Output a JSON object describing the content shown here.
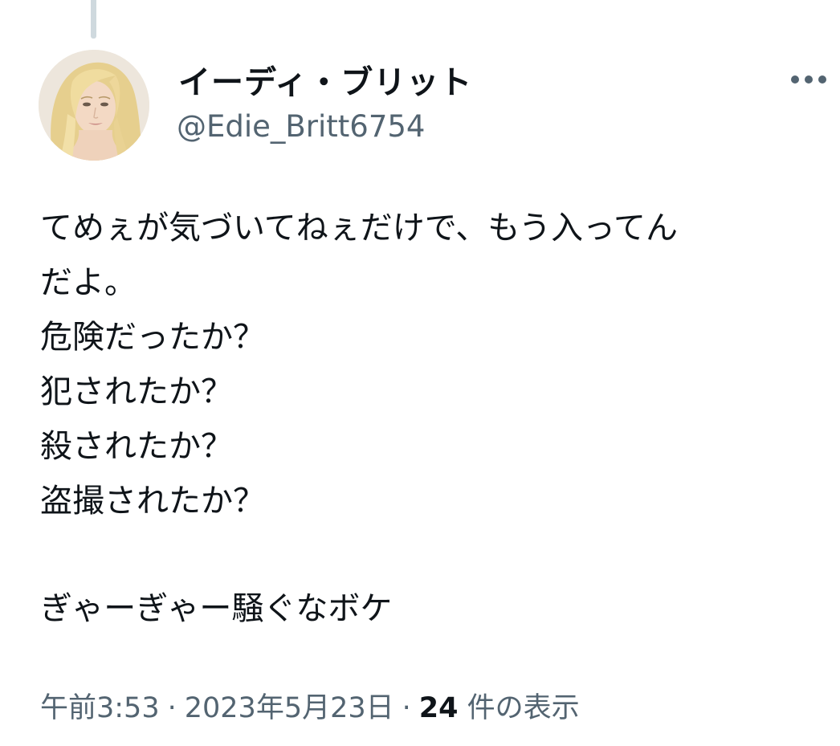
{
  "tweet": {
    "author": {
      "display_name": "イーディ・ブリット",
      "handle": "@Edie_Britt6754"
    },
    "more_icon": "more-horizontal-icon",
    "text_lines": [
      "てめぇが気づいてねぇだけで、もう入ってん",
      "だよ。",
      "危険だったか？",
      "犯されたか？",
      "殺されたか？",
      "盗撮されたか？",
      "",
      "ぎゃーぎゃー騒ぐなボケ"
    ],
    "meta": {
      "time": "午前3:53",
      "separator": "·",
      "date": "2023年5月23日",
      "views_count": "24",
      "views_label": " 件の表示"
    }
  },
  "colors": {
    "text_primary": "#0f1419",
    "text_secondary": "#536471",
    "thread_line": "#cfd9de"
  }
}
